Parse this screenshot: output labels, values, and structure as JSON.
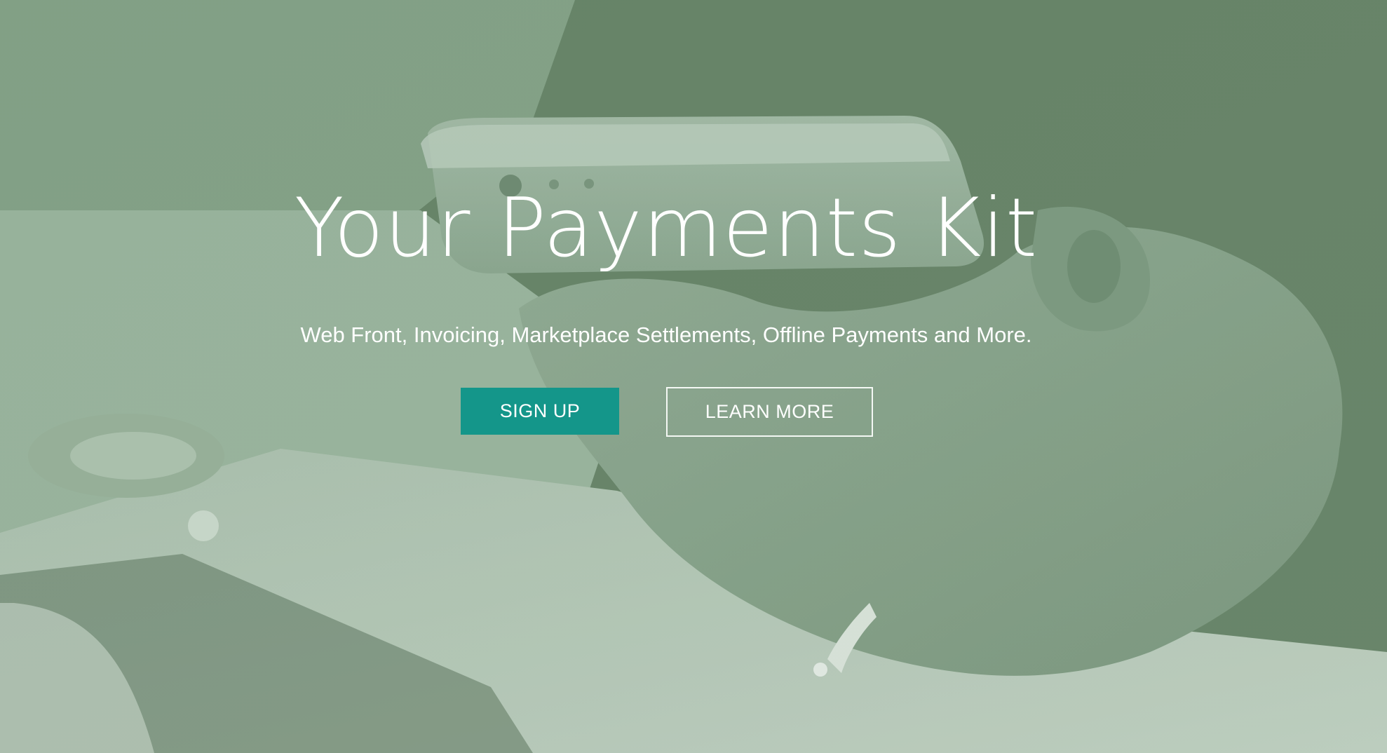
{
  "hero": {
    "title": "Your Payments Kit",
    "subtitle": "Web Front, Invoicing, Marketplace Settlements, Offline Payments and More.",
    "background_image": "hand-holding-phone-over-laptop",
    "tint_color": "#668266"
  },
  "actions": {
    "signup_label": "SIGN UP",
    "learn_more_label": "LEARN MORE",
    "signup_color": "#14968a"
  }
}
